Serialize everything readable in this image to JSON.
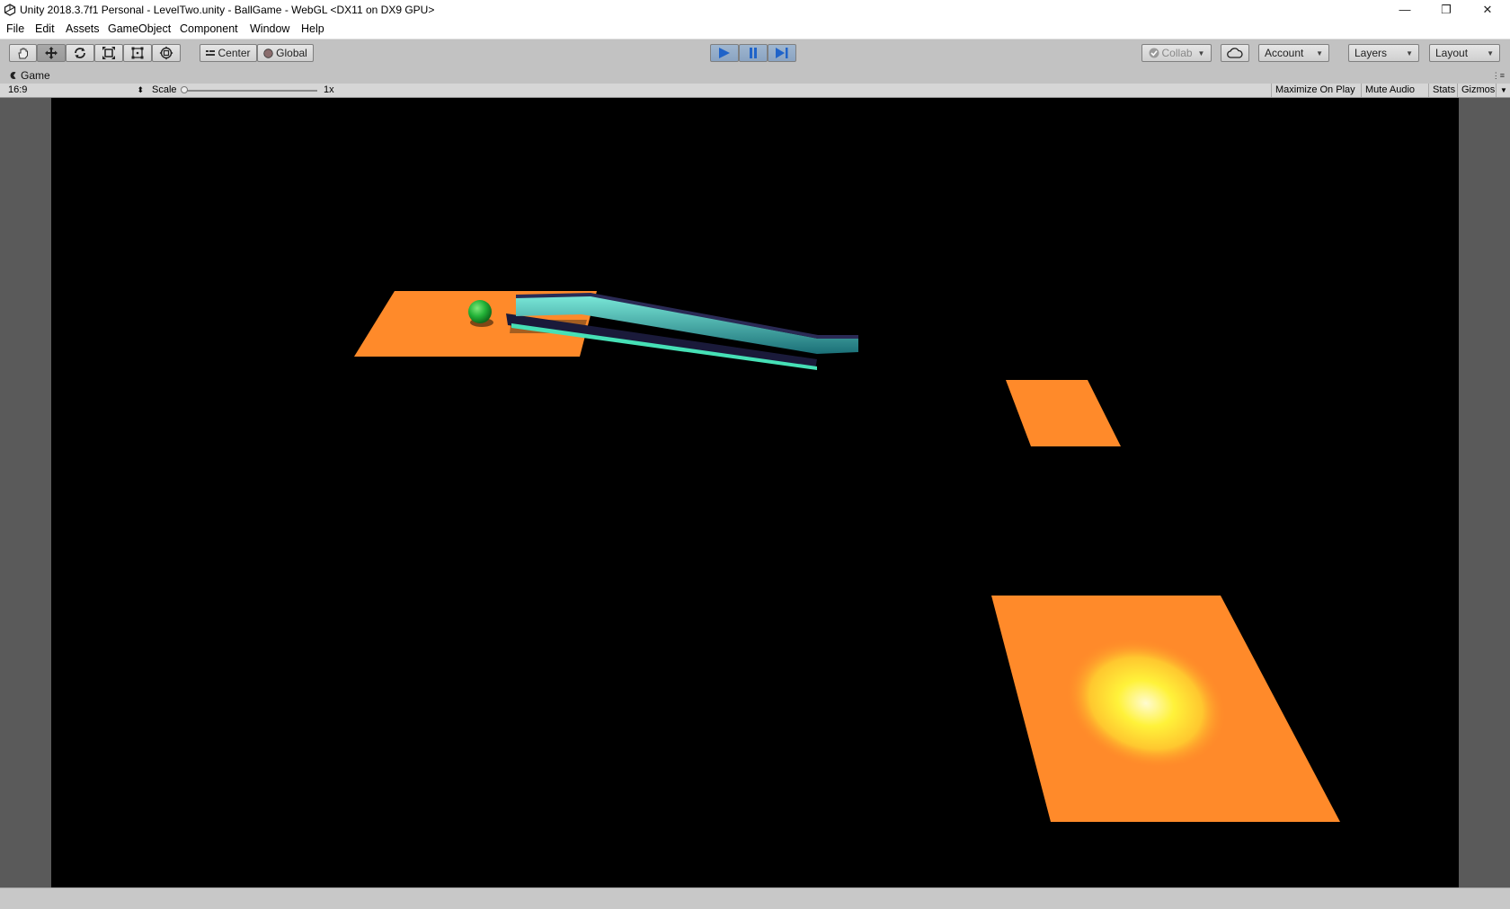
{
  "window": {
    "title": "Unity 2018.3.7f1 Personal - LevelTwo.unity - BallGame - WebGL <DX11 on DX9 GPU>",
    "minimize": "—",
    "restore": "❐",
    "close": "✕"
  },
  "menu": [
    "File",
    "Edit",
    "Assets",
    "GameObject",
    "Component",
    "Window",
    "Help"
  ],
  "toolbar": {
    "tools": [
      "hand-tool-icon",
      "move-tool-icon",
      "rotate-tool-icon",
      "scale-tool-icon",
      "rect-tool-icon",
      "transform-tool-icon"
    ],
    "pivot_label": "Center",
    "space_label": "Global",
    "collab_label": "Collab",
    "account_label": "Account",
    "layers_label": "Layers",
    "layout_label": "Layout",
    "play_active": true
  },
  "game_tab": {
    "title": "Game",
    "aspect": "16:9",
    "scale_label": "Scale",
    "scale_value": "1x",
    "maximize_on_play": "Maximize On Play",
    "mute_audio": "Mute Audio",
    "stats": "Stats",
    "gizmos": "Gizmos"
  },
  "colors": {
    "platform_orange": "#ff8a2a",
    "ramp_teal": "#3ec8b4",
    "ball_green": "#2cbc3c",
    "viewport_bg": "#000000",
    "light_spot": "#fff23a"
  }
}
